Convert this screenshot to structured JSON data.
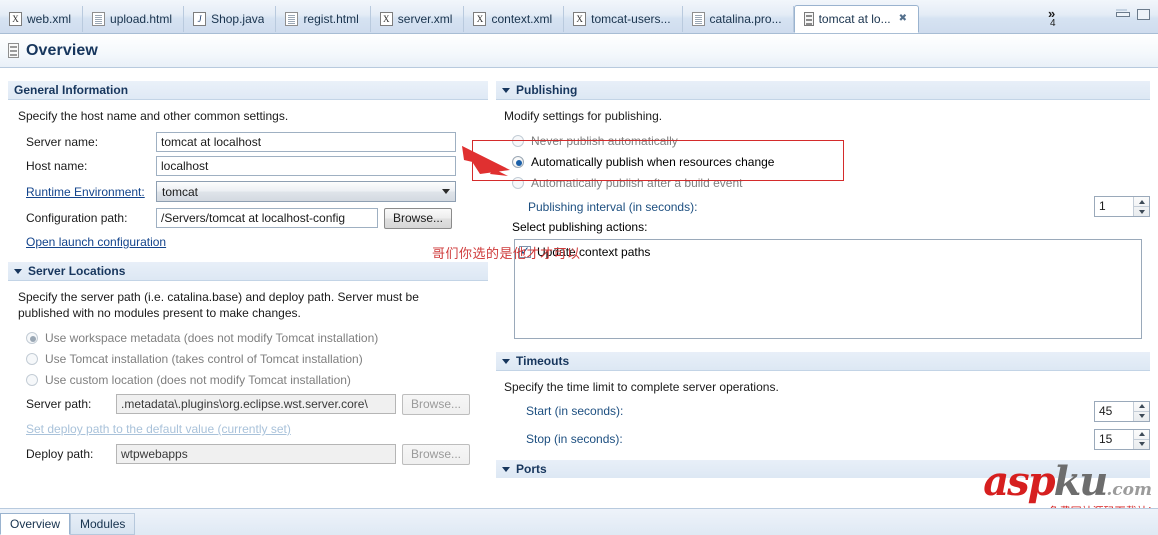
{
  "window": {
    "minimize_label": "Minimize",
    "maximize_label": "Maximize",
    "overflow_indicator": "»",
    "overflow_count": "4"
  },
  "editor_tabs": [
    {
      "label": "web.xml",
      "icon": "xml-file-icon",
      "glyph": "X",
      "active": false,
      "closable": false
    },
    {
      "label": "upload.html",
      "icon": "html-file-icon",
      "glyph": "",
      "active": false,
      "closable": false
    },
    {
      "label": "Shop.java",
      "icon": "java-file-icon",
      "glyph": "J",
      "active": false,
      "closable": false
    },
    {
      "label": "regist.html",
      "icon": "html-file-icon",
      "glyph": "",
      "active": false,
      "closable": false
    },
    {
      "label": "server.xml",
      "icon": "xml-file-icon",
      "glyph": "X",
      "active": false,
      "closable": false
    },
    {
      "label": "context.xml",
      "icon": "xml-file-icon",
      "glyph": "X",
      "active": false,
      "closable": false
    },
    {
      "label": "tomcat-users...",
      "icon": "xml-file-icon",
      "glyph": "X",
      "active": false,
      "closable": false
    },
    {
      "label": "catalina.pro...",
      "icon": "html-file-icon",
      "glyph": "",
      "active": false,
      "closable": false
    },
    {
      "label": "tomcat at lo...",
      "icon": "server-icon",
      "glyph": "",
      "active": true,
      "closable": true
    }
  ],
  "header": {
    "title": "Overview",
    "icon": "server-icon"
  },
  "general_information": {
    "title": "General Information",
    "description": "Specify the host name and other common settings.",
    "server_name_label": "Server name:",
    "server_name_value": "tomcat at localhost",
    "host_name_label": "Host name:",
    "host_name_value": "localhost",
    "runtime_environment_label": "Runtime Environment:",
    "runtime_environment_value": "tomcat",
    "configuration_path_label": "Configuration path:",
    "configuration_path_value": "/Servers/tomcat at localhost-config",
    "browse_label": "Browse...",
    "open_launch_configuration": "Open launch configuration"
  },
  "server_locations": {
    "title": "Server Locations",
    "description": "Specify the server path (i.e. catalina.base) and deploy path. Server must be published with no modules present to make changes.",
    "options": [
      {
        "label": "Use workspace metadata (does not modify Tomcat installation)",
        "selected": true
      },
      {
        "label": "Use Tomcat installation (takes control of Tomcat installation)",
        "selected": false
      },
      {
        "label": "Use custom location (does not modify Tomcat installation)",
        "selected": false
      }
    ],
    "server_path_label": "Server path:",
    "server_path_value": ".metadata\\.plugins\\org.eclipse.wst.server.core\\",
    "server_path_browse": "Browse...",
    "set_deploy_path_link": "Set deploy path to the default value (currently set)",
    "deploy_path_label": "Deploy path:",
    "deploy_path_value": "wtpwebapps",
    "deploy_path_browse": "Browse..."
  },
  "publishing": {
    "title": "Publishing",
    "description": "Modify settings for publishing.",
    "options": [
      {
        "label": "Never publish automatically",
        "selected": false
      },
      {
        "label": "Automatically publish when resources change",
        "selected": true
      },
      {
        "label": "Automatically publish after a build event",
        "selected": false
      }
    ],
    "interval_label": "Publishing interval (in seconds):",
    "interval_value": "1",
    "actions_label": "Select publishing actions:",
    "actions": [
      {
        "label": "Update context paths",
        "checked": true
      }
    ]
  },
  "timeouts": {
    "title": "Timeouts",
    "description": "Specify the time limit to complete server operations.",
    "start_label": "Start (in seconds):",
    "start_value": "45",
    "stop_label": "Stop (in seconds):",
    "stop_value": "15"
  },
  "ports": {
    "title": "Ports"
  },
  "bottom_tabs": [
    {
      "label": "Overview",
      "active": true
    },
    {
      "label": "Modules",
      "active": false
    }
  ],
  "annotations": {
    "chinese_note": "哥们你选的是他才才可以",
    "highlight_color": "#d42b2b",
    "arrow_color": "#e03030"
  },
  "watermark": {
    "asp": "asp",
    "ku": "ku",
    "com": ".com",
    "subtitle": "免费网站源码下载站!"
  }
}
